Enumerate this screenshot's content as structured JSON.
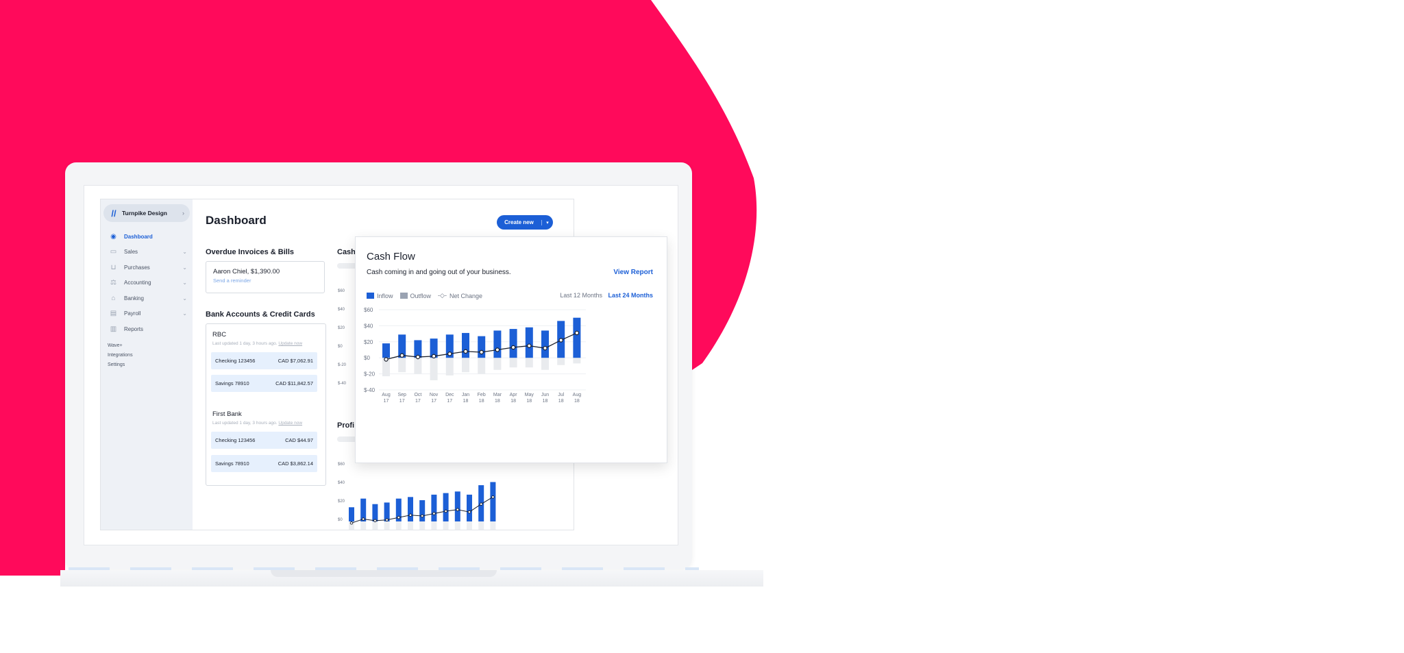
{
  "colors": {
    "background_blob": "#ff0a5b",
    "accent": "#1c5fd6",
    "inflow": "#1c5fd6",
    "outflow": "#e6e8ec"
  },
  "app": {
    "business_name": "Turnpike Design",
    "page_title": "Dashboard",
    "create_button": "Create new",
    "nav": [
      {
        "label": "Dashboard",
        "icon": "dashboard-icon",
        "active": true
      },
      {
        "label": "Sales",
        "icon": "sales-icon",
        "expandable": true
      },
      {
        "label": "Purchases",
        "icon": "cart-icon",
        "expandable": true
      },
      {
        "label": "Accounting",
        "icon": "scale-icon",
        "expandable": true
      },
      {
        "label": "Banking",
        "icon": "bank-icon",
        "expandable": true
      },
      {
        "label": "Payroll",
        "icon": "payroll-icon",
        "expandable": true
      },
      {
        "label": "Reports",
        "icon": "chart-icon"
      }
    ],
    "nav_extra": [
      "Wave+",
      "Integrations",
      "Settings"
    ]
  },
  "overdue": {
    "title": "Overdue Invoices & Bills",
    "invoice": "Aaron Chiel, $1,390.00",
    "reminder": "Send a reminder"
  },
  "banks": {
    "title": "Bank Accounts & Credit Cards",
    "list": [
      {
        "name": "RBC",
        "updated": "Last updated 1 day, 3 hours ago.",
        "update_link": "Update now",
        "accounts": [
          {
            "name": "Checking 123456",
            "balance": "CAD $7,062.91"
          },
          {
            "name": "Savings 78910",
            "balance": "CAD $11,842.57"
          }
        ]
      },
      {
        "name": "First Bank",
        "updated": "Last updated 1 day, 3 hours ago.",
        "update_link": "Update now",
        "accounts": [
          {
            "name": "Checking 123456",
            "balance": "CAD $44.97"
          },
          {
            "name": "Savings 78910",
            "balance": "CAD $3,862.14"
          }
        ]
      }
    ]
  },
  "background_panels": {
    "cash_title_partial": "Cash",
    "profit_title_partial": "Profi",
    "upper_ticks": [
      "$60",
      "$40",
      "$20",
      "$0",
      "$-20",
      "$-40"
    ],
    "lower_ticks": [
      "$60",
      "$40",
      "$20",
      "$0"
    ]
  },
  "cash_flow": {
    "title": "Cash Flow",
    "subtitle": "Cash coming in and going out of your business.",
    "view_report": "View Report",
    "legend": [
      "Inflow",
      "Outflow",
      "Net Change"
    ],
    "range_options": [
      "Last 12 Months",
      "Last 24 Months"
    ],
    "selected_range": "Last 24 Months"
  },
  "chart_data": [
    {
      "type": "bar",
      "title": "Cash Flow",
      "categories": [
        "Aug 17",
        "Sep 17",
        "Oct 17",
        "Nov 17",
        "Dec 17",
        "Jan 18",
        "Feb 18",
        "Mar 18",
        "Apr 18",
        "May 18",
        "Jun 18",
        "Jul 18",
        "Aug 18"
      ],
      "category_lines": [
        [
          "Aug",
          "17"
        ],
        [
          "Sep",
          "17"
        ],
        [
          "Oct",
          "17"
        ],
        [
          "Nov",
          "17"
        ],
        [
          "Dec",
          "17"
        ],
        [
          "Jan",
          "18"
        ],
        [
          "Feb",
          "18"
        ],
        [
          "Mar",
          "18"
        ],
        [
          "Apr",
          "18"
        ],
        [
          "May",
          "18"
        ],
        [
          "Jun",
          "18"
        ],
        [
          "Jul",
          "18"
        ],
        [
          "Aug",
          "18"
        ]
      ],
      "series": [
        {
          "name": "Inflow",
          "values": [
            18,
            29,
            22,
            24,
            29,
            31,
            27,
            34,
            36,
            38,
            34,
            46,
            50
          ]
        },
        {
          "name": "Outflow",
          "values": [
            -23,
            -18,
            -20,
            -28,
            -22,
            -18,
            -20,
            -15,
            -12,
            -12,
            -15,
            -9,
            -7
          ]
        },
        {
          "name": "Net Change",
          "values": [
            -2,
            3,
            1,
            2,
            5,
            8,
            7,
            10,
            13,
            15,
            12,
            22,
            31
          ]
        }
      ],
      "yticks": [
        "$60",
        "$40",
        "$20",
        "$0",
        "$-20",
        "$-40"
      ],
      "ylim": [
        -40,
        60
      ],
      "grid": true,
      "legend": "top-left"
    }
  ]
}
